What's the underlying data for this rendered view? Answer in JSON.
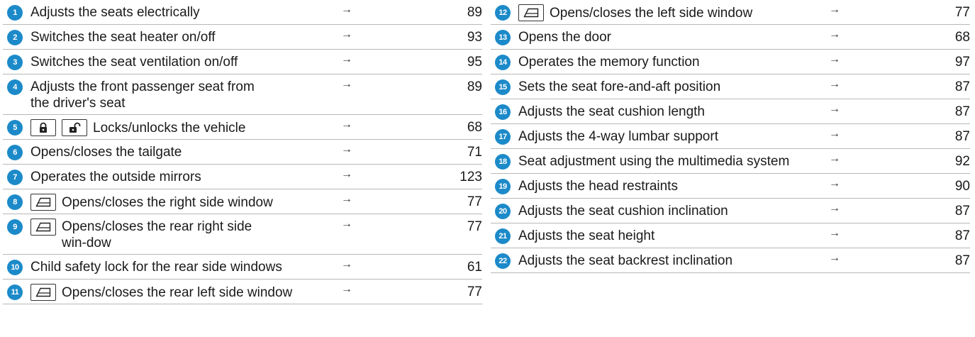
{
  "arrow_symbol": "→",
  "left_column": [
    {
      "num": "1",
      "text": "Adjusts the seats electrically",
      "page": "89"
    },
    {
      "num": "2",
      "text": "Switches the seat heater on/off",
      "page": "93"
    },
    {
      "num": "3",
      "text": "Switches the seat ventilation on/off",
      "page": "95"
    },
    {
      "num": "4",
      "text": "Adjusts the front passenger seat from the driver's seat",
      "page": "89"
    },
    {
      "num": "5",
      "text": "Locks/unlocks the vehicle",
      "page": "68",
      "icons": [
        "lock-icon",
        "unlock-icon"
      ]
    },
    {
      "num": "6",
      "text": "Opens/closes the tailgate",
      "page": "71"
    },
    {
      "num": "7",
      "text": "Operates the outside mirrors",
      "page": "123"
    },
    {
      "num": "8",
      "text": "Opens/closes the right side window",
      "page": "77",
      "icons": [
        "window-icon"
      ]
    },
    {
      "num": "9",
      "text": "Opens/closes the rear right side win-dow",
      "page": "77",
      "icons": [
        "window-icon"
      ]
    },
    {
      "num": "10",
      "text": "Child safety lock for the rear side windows",
      "page": "61"
    },
    {
      "num": "11",
      "text": "Opens/closes the rear left side window",
      "page": "77",
      "icons": [
        "window-icon"
      ]
    }
  ],
  "right_column": [
    {
      "num": "12",
      "text": "Opens/closes the left side window",
      "page": "77",
      "icons": [
        "window-icon"
      ]
    },
    {
      "num": "13",
      "text": "Opens the door",
      "page": "68"
    },
    {
      "num": "14",
      "text": "Operates the memory function",
      "page": "97"
    },
    {
      "num": "15",
      "text": "Sets the seat fore-and-aft position",
      "page": "87"
    },
    {
      "num": "16",
      "text": "Adjusts the seat cushion length",
      "page": "87"
    },
    {
      "num": "17",
      "text": "Adjusts the 4-way lumbar support",
      "page": "87"
    },
    {
      "num": "18",
      "text": "Seat adjustment using the multimedia system",
      "page": "92"
    },
    {
      "num": "19",
      "text": "Adjusts the head restraints",
      "page": "90"
    },
    {
      "num": "20",
      "text": "Adjusts the seat cushion inclination",
      "page": "87"
    },
    {
      "num": "21",
      "text": "Adjusts the seat height",
      "page": "87"
    },
    {
      "num": "22",
      "text": "Adjusts the seat backrest inclination",
      "page": "87"
    }
  ],
  "colors": {
    "badge": "#1c8ac9",
    "rule": "#b8b8b8",
    "text": "#1a1a1a"
  }
}
